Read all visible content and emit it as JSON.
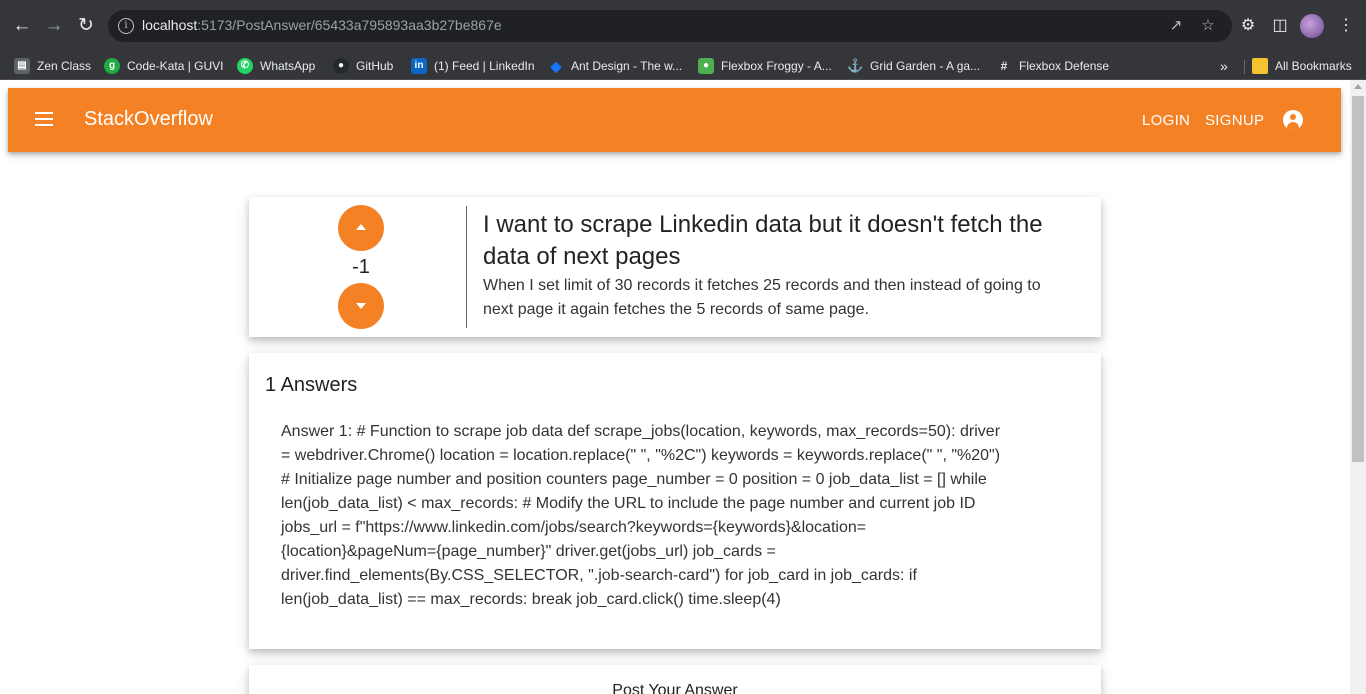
{
  "browser": {
    "url_host": "localhost",
    "url_path": ":5173/PostAnswer/65433a795893aa3b27be867e",
    "bookmarks": [
      {
        "label": "Zen Class",
        "icon": "zen-class-icon",
        "color": "#5f6368"
      },
      {
        "label": "Code-Kata | GUVI",
        "icon": "guvi-icon",
        "color": "#1faa42"
      },
      {
        "label": "WhatsApp",
        "icon": "whatsapp-icon",
        "color": "#25d366"
      },
      {
        "label": "GitHub",
        "icon": "github-icon",
        "color": "#24292e"
      },
      {
        "label": "(1) Feed | LinkedIn",
        "icon": "linkedin-icon",
        "color": "#0a66c2"
      },
      {
        "label": "Ant Design - The w...",
        "icon": "ant-design-icon",
        "color": "#1677ff"
      },
      {
        "label": "Flexbox Froggy - A...",
        "icon": "froggy-icon",
        "color": "#4caf50"
      },
      {
        "label": "Grid Garden - A ga...",
        "icon": "grid-garden-icon",
        "color": "#d4a017"
      },
      {
        "label": "Flexbox Defense",
        "icon": "flexbox-defense-icon",
        "color": "#35363a"
      }
    ],
    "all_bookmarks_label": "All Bookmarks"
  },
  "header": {
    "brand": "StackOverflow",
    "login_label": "LOGIN",
    "signup_label": "SIGNUP",
    "accent_color": "#f48225"
  },
  "question": {
    "votes": "-1",
    "title": "I want to scrape Linkedin data but it doesn't fetch the data of next pages",
    "body": "When I set limit of 30 records it fetches 25 records and then instead of going to next page it again fetches the 5 records of same page."
  },
  "answers": {
    "heading": "1 Answers",
    "items": [
      {
        "text": "Answer 1: # Function to scrape job data def scrape_jobs(location, keywords, max_records=50): driver = webdriver.Chrome() location = location.replace(\" \", \"%2C\") keywords = keywords.replace(\" \", \"%20\") # Initialize page number and position counters page_number = 0 position = 0 job_data_list = [] while len(job_data_list) < max_records: # Modify the URL to include the page number and current job ID jobs_url = f\"https://www.linkedin.com/jobs/search?keywords={keywords}&location={location}&pageNum={page_number}\" driver.get(jobs_url) job_cards = driver.find_elements(By.CSS_SELECTOR, \".job-search-card\") for job_card in job_cards: if len(job_data_list) == max_records: break job_card.click() time.sleep(4)"
      }
    ]
  },
  "post_answer": {
    "heading": "Post Your Answer"
  }
}
